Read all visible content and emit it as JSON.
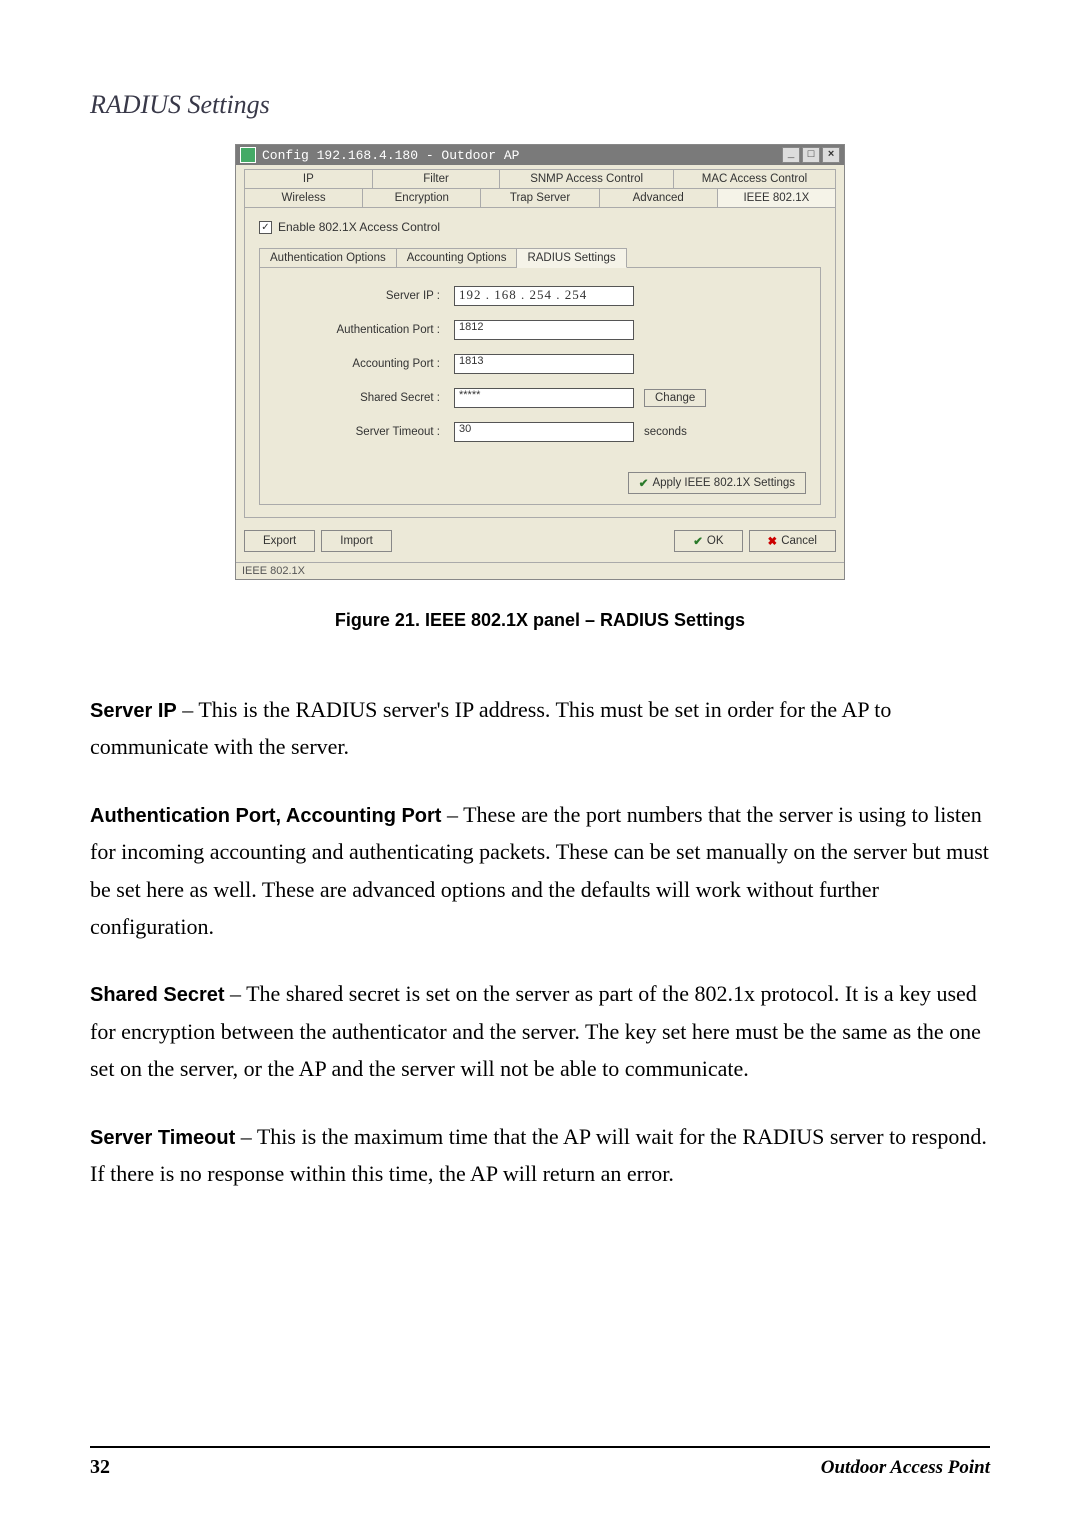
{
  "section_title": "RADIUS Settings",
  "window": {
    "title": "Config 192.168.4.180 - Outdoor AP",
    "tabs_row1": [
      "IP",
      "Filter",
      "SNMP Access Control",
      "MAC Access Control"
    ],
    "tabs_row2": [
      "Wireless",
      "Encryption",
      "Trap Server",
      "Advanced",
      "IEEE 802.1X"
    ],
    "enable_label": "Enable 802.1X Access Control",
    "enable_checked": "✓",
    "subtabs": [
      "Authentication Options",
      "Accounting Options",
      "RADIUS Settings"
    ],
    "form": {
      "server_ip_label": "Server IP :",
      "server_ip_value": "192 . 168 . 254 . 254",
      "auth_port_label": "Authentication Port :",
      "auth_port_value": "1812",
      "acct_port_label": "Accounting Port :",
      "acct_port_value": "1813",
      "shared_secret_label": "Shared Secret :",
      "shared_secret_value": "*****",
      "change_btn": "Change",
      "server_timeout_label": "Server Timeout :",
      "server_timeout_value": "30",
      "seconds_label": "seconds"
    },
    "apply_btn": "Apply IEEE 802.1X Settings",
    "export_btn": "Export",
    "import_btn": "Import",
    "ok_btn": "OK",
    "cancel_btn": "Cancel",
    "statusbar": "IEEE 802.1X"
  },
  "figure_caption": "Figure 21.  IEEE 802.1X panel – RADIUS Settings",
  "body": {
    "server_ip_term": "Server IP",
    "server_ip_text": " – This is the RADIUS server's IP address. This must be set in order for the AP to communicate with the server.",
    "ports_term": "Authentication Port, Accounting Port",
    "ports_text": " – These are the port numbers that the server is using to listen for incoming accounting and authenticating packets. These can be set manually on the server but must be set here as well. These are advanced options and the defaults will work without further configuration.",
    "secret_term": "Shared Secret",
    "secret_text": " – The shared secret is set on the server as part of the 802.1x protocol. It is a key used for encryption between the authenticator and the server. The key set here must be the same as the one set on the server, or the AP and the server will not be able to communicate.",
    "timeout_term": "Server Timeout",
    "timeout_text": " – This is the maximum time that the AP will wait for the RADIUS server to respond. If there is no response within this time, the AP will return an error."
  },
  "footer": {
    "page": "32",
    "right": "Outdoor Access Point"
  }
}
